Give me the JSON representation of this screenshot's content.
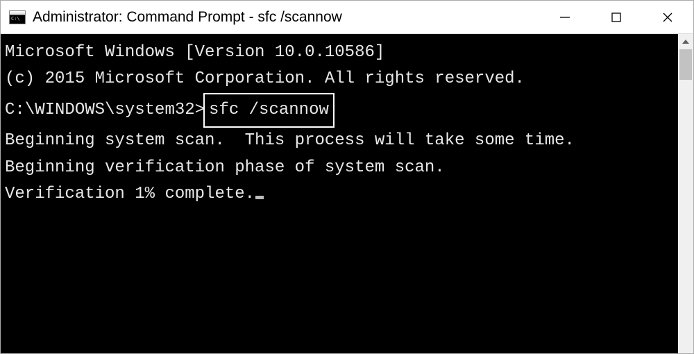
{
  "titlebar": {
    "title": "Administrator: Command Prompt - sfc  /scannow"
  },
  "terminal": {
    "line1": "Microsoft Windows [Version 10.0.10586]",
    "line2": "(c) 2015 Microsoft Corporation. All rights reserved.",
    "blank1": "",
    "prompt_prefix": "C:\\WINDOWS\\system32>",
    "command": "sfc /scannow",
    "blank2": "",
    "line3": "Beginning system scan.  This process will take some time.",
    "blank3": "",
    "line4": "Beginning verification phase of system scan.",
    "line5_prefix": "Verification 1% complete."
  }
}
